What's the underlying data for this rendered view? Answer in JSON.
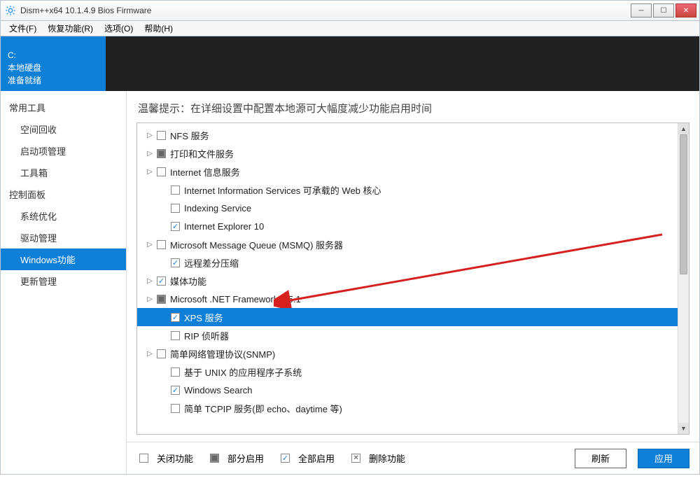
{
  "window": {
    "title": "Dism++x64 10.1.4.9 Bios Firmware",
    "min": "—",
    "max": "▢",
    "close": "✕"
  },
  "menu": {
    "file": "文件(F)",
    "restore": "恢复功能(R)",
    "options": "选项(O)",
    "help": "帮助(H)"
  },
  "drive": {
    "letter": "C:",
    "type": "本地硬盘",
    "status": "准备就绪"
  },
  "sidebar": {
    "group1": "常用工具",
    "items1": [
      "空间回收",
      "启动项管理",
      "工具箱"
    ],
    "group2": "控制面板",
    "items2": [
      "系统优化",
      "驱动管理",
      "Windows功能",
      "更新管理"
    ],
    "selected": "Windows功能"
  },
  "tip": "温馨提示：在详细设置中配置本地源可大幅度减少功能启用时间",
  "tree": [
    {
      "indent": 1,
      "expand": true,
      "state": "unchecked",
      "label": "NFS 服务"
    },
    {
      "indent": 1,
      "expand": true,
      "state": "mixed",
      "label": "打印和文件服务"
    },
    {
      "indent": 1,
      "expand": true,
      "state": "unchecked",
      "label": "Internet 信息服务"
    },
    {
      "indent": 2,
      "expand": false,
      "state": "unchecked",
      "label": "Internet Information Services 可承载的 Web 核心"
    },
    {
      "indent": 2,
      "expand": false,
      "state": "unchecked",
      "label": "Indexing Service"
    },
    {
      "indent": 2,
      "expand": false,
      "state": "checked",
      "label": "Internet Explorer 10"
    },
    {
      "indent": 1,
      "expand": true,
      "state": "unchecked",
      "label": "Microsoft Message Queue (MSMQ) 服务器"
    },
    {
      "indent": 2,
      "expand": false,
      "state": "checked",
      "label": "远程差分压缩"
    },
    {
      "indent": 1,
      "expand": true,
      "state": "checked",
      "label": "媒体功能"
    },
    {
      "indent": 1,
      "expand": true,
      "state": "mixed",
      "label": "Microsoft .NET Framework 3.5.1"
    },
    {
      "indent": 2,
      "expand": false,
      "state": "checked",
      "label": "XPS 服务",
      "selected": true
    },
    {
      "indent": 2,
      "expand": false,
      "state": "unchecked",
      "label": "RIP 侦听器"
    },
    {
      "indent": 1,
      "expand": true,
      "state": "unchecked",
      "label": "简单网络管理协议(SNMP)"
    },
    {
      "indent": 2,
      "expand": false,
      "state": "unchecked",
      "label": "基于 UNIX 的应用程序子系统"
    },
    {
      "indent": 2,
      "expand": false,
      "state": "checked",
      "label": "Windows Search"
    },
    {
      "indent": 2,
      "expand": false,
      "state": "unchecked",
      "label": "简单 TCPIP 服务(即 echo、daytime 等)"
    }
  ],
  "legend": {
    "off": "关闭功能",
    "partial": "部分启用",
    "on": "全部启用",
    "del": "删除功能"
  },
  "buttons": {
    "refresh": "刷新",
    "apply": "应用"
  }
}
